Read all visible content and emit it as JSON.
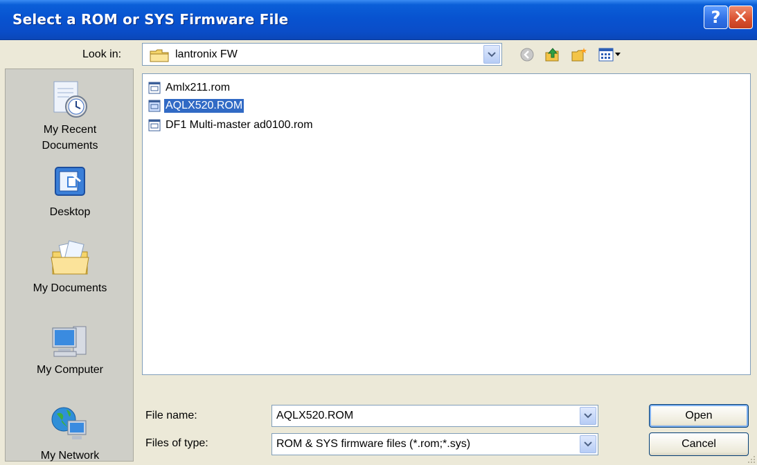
{
  "window": {
    "title": "Select a ROM or SYS Firmware File",
    "help_glyph": "?",
    "close_glyph": "✕"
  },
  "lookin": {
    "label": "Look in:",
    "value": "lantronix FW"
  },
  "toolbar": {
    "icons": [
      "back-icon",
      "up-folder-icon",
      "new-folder-icon",
      "views-menu-icon"
    ]
  },
  "places": [
    {
      "label": "My Recent\nDocuments",
      "icon": "recent-documents-icon"
    },
    {
      "label": "Desktop",
      "icon": "desktop-icon"
    },
    {
      "label": "My Documents",
      "icon": "my-documents-icon"
    },
    {
      "label": "My Computer",
      "icon": "my-computer-icon"
    },
    {
      "label": "My Network",
      "icon": "my-network-icon"
    }
  ],
  "files": [
    {
      "name": "Amlx211.rom",
      "selected": false
    },
    {
      "name": "AQLX520.ROM",
      "selected": true
    },
    {
      "name": "DF1 Multi-master ad0100.rom",
      "selected": false
    }
  ],
  "form": {
    "file_name_label": "File name:",
    "file_name_value": "AQLX520.ROM",
    "file_type_label": "Files of type:",
    "file_type_value": "ROM & SYS firmware files (*.rom;*.sys)"
  },
  "buttons": {
    "open": "Open",
    "cancel": "Cancel"
  },
  "colors": {
    "titlebar": "#0853d0",
    "selection": "#316ac5",
    "dialog_bg": "#ece9d8"
  }
}
